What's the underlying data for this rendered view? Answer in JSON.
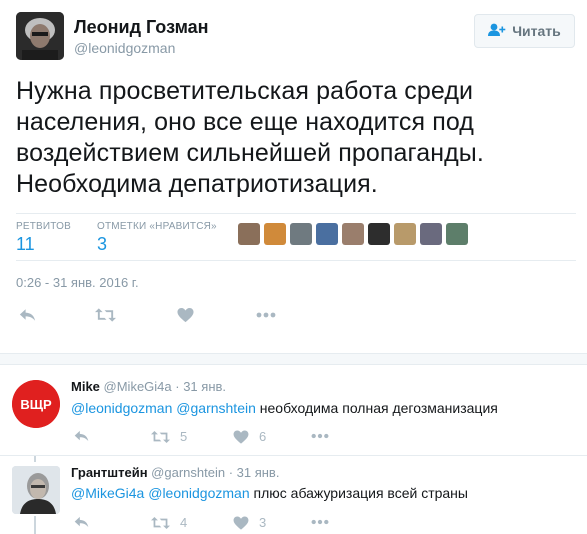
{
  "tweet": {
    "author_name": "Леонид Гозман",
    "author_handle": "@leonidgozman",
    "follow_label": "Читать",
    "text": "Нужна просветительская работа среди населения, оно все еще находится под воздействием сильнейшей пропаганды. Необходима депатриотизация.",
    "retweets_label": "РЕТВИТОВ",
    "retweets": "11",
    "likes_label": "ОТМЕТКИ «НРАВИТСЯ»",
    "likes": "3",
    "timestamp": "0:26 - 31 янв. 2016 г.",
    "liker_avatar_colors": [
      "#8a6f5a",
      "#d08a3a",
      "#6f7a80",
      "#4a6fa0",
      "#9a7e6c",
      "#2d2d2d",
      "#b89a6a",
      "#6a6a7e",
      "#5d7e6a"
    ]
  },
  "replies": [
    {
      "author_name": "Mike",
      "author_handle": "@MikeGi4a",
      "time": "· 31 янв.",
      "avatar_text": "ВЩР",
      "mentions": [
        "@leonidgozman",
        "@garnshtein"
      ],
      "text": "необходима полная дегозманизация",
      "retweets": "5",
      "likes": "6"
    },
    {
      "author_name": "Грантштейн",
      "author_handle": "@garnshtein",
      "time": "· 31 янв.",
      "mentions": [
        "@MikeGi4a",
        "@leonidgozman"
      ],
      "text": "плюс абажуризация всей страны",
      "retweets": "4",
      "likes": "3"
    }
  ],
  "colors": {
    "link": "#1b95e0",
    "muted": "#8899a6",
    "icon": "#aab8c2",
    "vschr_red": "#e0201f"
  },
  "icons": [
    "user-plus-icon",
    "reply-icon",
    "retweet-icon",
    "heart-icon",
    "more-icon"
  ]
}
